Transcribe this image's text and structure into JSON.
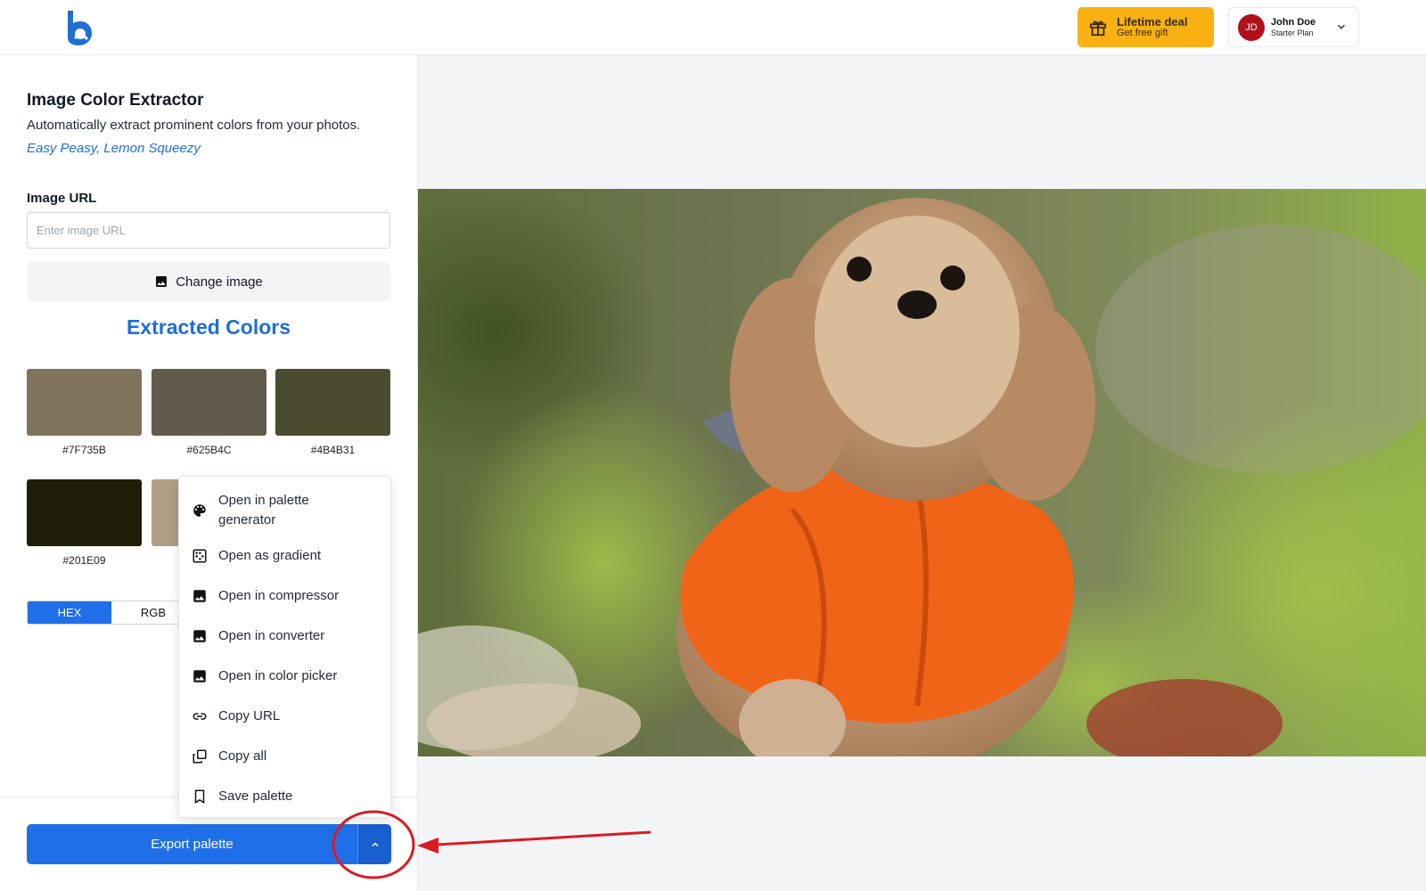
{
  "header": {
    "logo_icon": "brand-b-logo-icon",
    "deal": {
      "title": "Lifetime deal",
      "subtitle": "Get free gift",
      "icon": "gift-icon",
      "color": "#FBB014"
    },
    "user": {
      "initials": "JD",
      "name": "John Doe",
      "plan": "Starter Plan",
      "avatar_color": "#B0101A",
      "icon": "chevron-down-icon"
    }
  },
  "panel": {
    "title": "Image Color Extractor",
    "description": "Automatically extract prominent colors from your photos.",
    "tagline": "Easy Peasy, Lemon Squeezy",
    "url_label": "Image URL",
    "url_placeholder": "Enter image URL",
    "url_value": "",
    "change_image_label": "Change image",
    "extracted_title": "Extracted Colors",
    "accent_color": "#1F6FE8"
  },
  "swatches": [
    {
      "hex": "#7F735B",
      "label": "#7F735B"
    },
    {
      "hex": "#625B4C",
      "label": "#625B4C"
    },
    {
      "hex": "#4B4B31",
      "label": "#4B4B31"
    },
    {
      "hex": "#201E09",
      "label": "#201E09"
    },
    {
      "hex": "#B09E86",
      "label": ""
    }
  ],
  "format_toggle": {
    "options": [
      "HEX",
      "RGB"
    ],
    "selected": "HEX"
  },
  "export": {
    "main_label": "Export palette",
    "toggle_icon": "chevron-up-icon"
  },
  "menu": {
    "items": [
      {
        "label": "Open in palette generator",
        "icon": "palette-icon"
      },
      {
        "label": "Open as gradient",
        "icon": "gradient-icon"
      },
      {
        "label": "Open in compressor",
        "icon": "image-icon"
      },
      {
        "label": "Open in converter",
        "icon": "image-icon"
      },
      {
        "label": "Open in color picker",
        "icon": "image-icon"
      },
      {
        "label": "Copy URL",
        "icon": "link-icon"
      },
      {
        "label": "Copy all",
        "icon": "copy-icon"
      },
      {
        "label": "Save palette",
        "icon": "bookmark-icon"
      }
    ]
  },
  "preview": {
    "image_icon": "dog-photo-image",
    "annotation_color": "#D81B22"
  }
}
